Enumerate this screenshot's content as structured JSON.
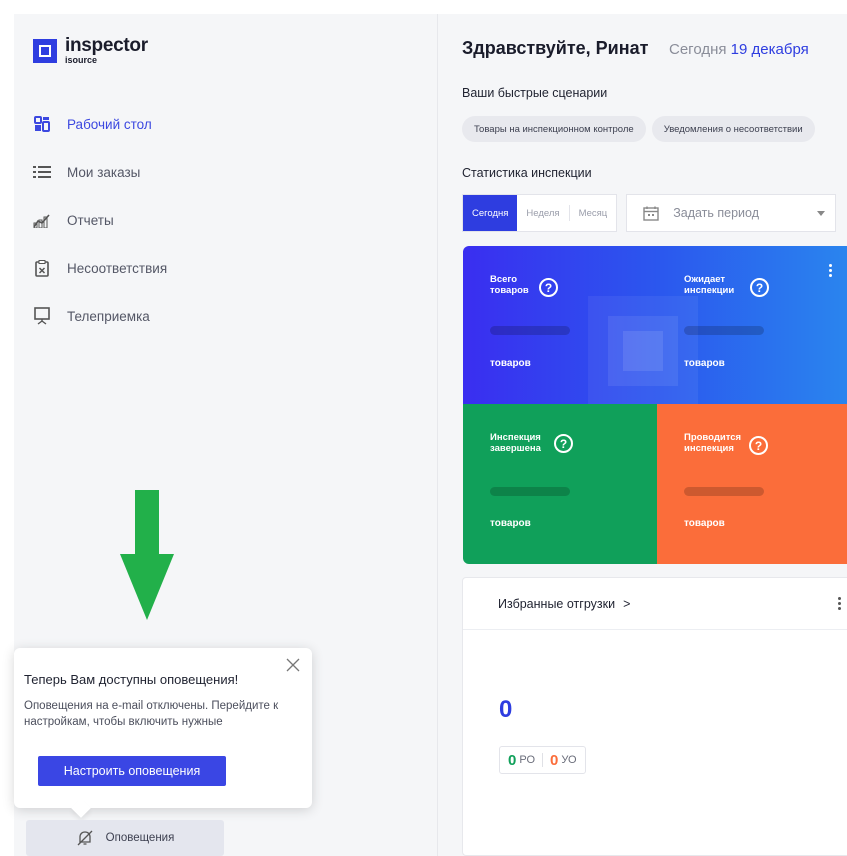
{
  "app": {
    "logo_name": "inspector",
    "logo_sub": "isource"
  },
  "sidebar": {
    "items": [
      {
        "label": "Рабочий стол",
        "icon": "dashboard-icon",
        "active": true
      },
      {
        "label": "Мои заказы",
        "icon": "list-icon",
        "active": false
      },
      {
        "label": "Отчеты",
        "icon": "bar-chart-icon",
        "active": false
      },
      {
        "label": "Несоответствия",
        "icon": "clipboard-x-icon",
        "active": false
      },
      {
        "label": "Телеприемка",
        "icon": "presentation-board-icon",
        "active": false
      }
    ],
    "notifications_button": "Оповещения"
  },
  "popup": {
    "title": "Теперь Вам доступны оповещения!",
    "text": "Оповещения на e-mail отключены. Перейдите к настройкам, чтобы включить нужные",
    "button": "Настроить оповещения"
  },
  "header": {
    "greeting": "Здравствуйте, Ринат",
    "today_prefix": "Сегодня",
    "today_date": "19 декабря"
  },
  "quick": {
    "label": "Ваши быстрые сценарии",
    "chips": [
      "Товары на инспекционном контроле",
      "Уведомления о несоответствии"
    ]
  },
  "stats": {
    "label": "Статистика инспекции",
    "periods": [
      "Сегодня",
      "Неделя",
      "Месяц"
    ],
    "active_period": "Сегодня",
    "date_placeholder": "Задать период",
    "tiles": [
      {
        "title": "Всего товаров",
        "units": "товаров",
        "color": "#3a2ef0"
      },
      {
        "title": "Ожидает инспекции",
        "units": "товаров",
        "color": "#2a86ee"
      },
      {
        "title": "Инспекция завершена",
        "units": "товаров",
        "color": "#10a05a"
      },
      {
        "title": "Проводится инспекция",
        "units": "товаров",
        "color": "#fb6d3a"
      }
    ],
    "help_glyph": "?"
  },
  "favorites": {
    "title": "Избранные отгрузки",
    "chevron": ">",
    "count": "0",
    "ro_value": "0",
    "ro_label": "РО",
    "uo_value": "0",
    "uo_label": "УО",
    "ro_color": "#10a05a",
    "uo_color": "#fb6d3a"
  },
  "colors": {
    "accent": "#2e3de0",
    "arrow": "#22b04a"
  }
}
